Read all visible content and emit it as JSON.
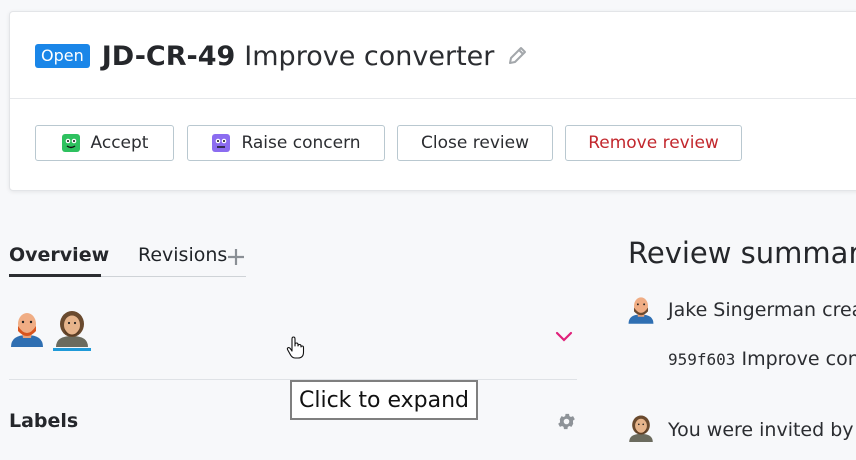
{
  "header": {
    "status_badge": "Open",
    "review_id": "JD-CR-49",
    "review_title": "Improve converter"
  },
  "actions": {
    "accept": "Accept",
    "raise_concern": "Raise concern",
    "close_review": "Close review",
    "remove_review": "Remove review"
  },
  "tabs": {
    "overview": "Overview",
    "revisions": "Revisions"
  },
  "labels_section": {
    "heading": "Labels"
  },
  "tooltip": {
    "text": "Click to expand"
  },
  "summary": {
    "title": "Review summary",
    "activity": [
      {
        "text": "Jake Singerman crea"
      },
      {
        "hash": "959f603",
        "message": "Improve con"
      },
      {
        "text": "You were invited by a"
      }
    ]
  },
  "colors": {
    "badge": "#1a86e8",
    "danger": "#c2272d",
    "chevron": "#e0217a",
    "avatar_underline": "#1f9ad8"
  },
  "icons": [
    "pencil-icon",
    "accept-emoji-icon",
    "concern-emoji-icon",
    "plus-icon",
    "chevron-down-icon",
    "gear-icon",
    "hand-cursor-icon"
  ]
}
